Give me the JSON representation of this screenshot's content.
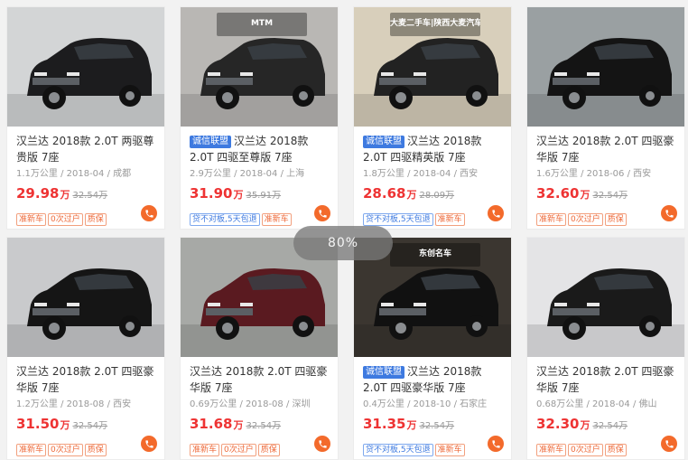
{
  "zoom_level": "80%",
  "listings": [
    {
      "badge": "",
      "title": "汉兰达 2018款 2.0T 两驱尊贵版 7座",
      "meta": "1.1万公里 / 2018-04 / 成都",
      "price": "29.98",
      "unit": "万",
      "original_price": "32.54万",
      "tags": [
        "准新车",
        "0次过户",
        "质保"
      ],
      "photo": {
        "bg": "#d3d5d6",
        "car": "#1c1c1e",
        "sign": ""
      }
    },
    {
      "badge": "诚信联盟",
      "title": "汉兰达 2018款 2.0T 四驱至尊版 7座",
      "meta": "2.9万公里 / 2018-04 / 上海",
      "price": "31.90",
      "unit": "万",
      "original_price": "35.91万",
      "tags": [
        "贷不对板,5天包退",
        "准新车"
      ],
      "photo": {
        "bg": "#b9b7b4",
        "car": "#262626",
        "sign": "MTM"
      }
    },
    {
      "badge": "诚信联盟",
      "title": "汉兰达 2018款 2.0T 四驱精英版 7座",
      "meta": "1.8万公里 / 2018-04 / 西安",
      "price": "28.68",
      "unit": "万",
      "original_price": "28.09万",
      "tags": [
        "贷不对板,5天包退",
        "准新车"
      ],
      "photo": {
        "bg": "#d8cfbb",
        "car": "#222222",
        "sign": "大麦二手车|陕西大麦汽车销售"
      }
    },
    {
      "badge": "",
      "title": "汉兰达 2018款 2.0T 四驱豪华版 7座",
      "meta": "1.6万公里 / 2018-06 / 西安",
      "price": "32.60",
      "unit": "万",
      "original_price": "32.54万",
      "tags": [
        "准新车",
        "0次过户",
        "质保"
      ],
      "photo": {
        "bg": "#9aa0a2",
        "car": "#141414",
        "sign": ""
      }
    },
    {
      "badge": "",
      "title": "汉兰达 2018款 2.0T 四驱豪华版 7座",
      "meta": "1.2万公里 / 2018-08 / 西安",
      "price": "31.50",
      "unit": "万",
      "original_price": "32.54万",
      "tags": [
        "准新车",
        "0次过户",
        "质保"
      ],
      "photo": {
        "bg": "#c9cacc",
        "car": "#151515",
        "sign": ""
      }
    },
    {
      "badge": "",
      "title": "汉兰达 2018款 2.0T 四驱豪华版 7座",
      "meta": "0.69万公里 / 2018-08 / 深圳",
      "price": "31.68",
      "unit": "万",
      "original_price": "32.54万",
      "tags": [
        "准新车",
        "0次过户",
        "质保"
      ],
      "photo": {
        "bg": "#a7a9a6",
        "car": "#5a1a20",
        "sign": ""
      }
    },
    {
      "badge": "诚信联盟",
      "title": "汉兰达 2018款 2.0T 四驱豪华版 7座",
      "meta": "0.4万公里 / 2018-10 / 石家庄",
      "price": "31.35",
      "unit": "万",
      "original_price": "32.54万",
      "tags": [
        "贷不对板,5天包退",
        "准新车"
      ],
      "photo": {
        "bg": "#3b3630",
        "car": "#111111",
        "sign": "东创名车"
      }
    },
    {
      "badge": "",
      "title": "汉兰达 2018款 2.0T 四驱豪华版 7座",
      "meta": "0.68万公里 / 2018-04 / 佛山",
      "price": "32.30",
      "unit": "万",
      "original_price": "32.54万",
      "tags": [
        "准新车",
        "0次过户",
        "质保"
      ],
      "photo": {
        "bg": "#e4e4e6",
        "car": "#1a1a1a",
        "sign": ""
      }
    }
  ],
  "colors": {
    "price": "#ee3333",
    "accent": "#f36a2b",
    "badge": "#3e7ae0"
  },
  "icons": {
    "phone": "phone-icon"
  }
}
